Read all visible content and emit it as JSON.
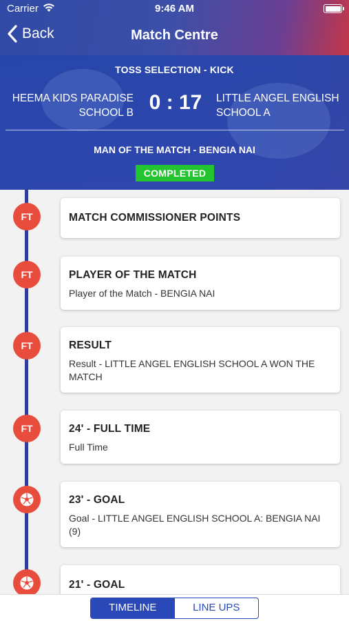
{
  "status_bar": {
    "carrier": "Carrier",
    "time": "9:46 AM"
  },
  "nav": {
    "back_label": "Back",
    "title": "Match Centre"
  },
  "match": {
    "toss": "TOSS SELECTION - KICK",
    "home_team": "HEEMA KIDS PARADISE SCHOOL B",
    "away_team": "LITTLE ANGEL ENGLISH SCHOOL A",
    "home_score": "0",
    "separator": ":",
    "away_score": "17",
    "man_of_match": "MAN OF THE MATCH - BENGIA NAI",
    "status": "COMPLETED"
  },
  "timeline": {
    "items": [
      {
        "marker": "FT",
        "icon": "",
        "title": "MATCH COMMISSIONER POINTS",
        "detail": ""
      },
      {
        "marker": "FT",
        "icon": "",
        "title": "PLAYER OF THE MATCH",
        "detail": "Player of the Match - BENGIA NAI"
      },
      {
        "marker": "FT",
        "icon": "",
        "title": "RESULT",
        "detail": "Result - LITTLE ANGEL ENGLISH SCHOOL A WON THE MATCH"
      },
      {
        "marker": "FT",
        "icon": "",
        "title": "24' - FULL TIME",
        "detail": "Full Time"
      },
      {
        "marker": "",
        "icon": "football-icon",
        "title": "23' - GOAL",
        "detail": "Goal - LITTLE ANGEL ENGLISH SCHOOL A: BENGIA NAI (9)"
      },
      {
        "marker": "",
        "icon": "football-icon",
        "title": "21' - GOAL",
        "detail": ""
      }
    ]
  },
  "tabs": {
    "timeline": "TIMELINE",
    "lineups": "LINE UPS",
    "active": "timeline"
  },
  "colors": {
    "primary": "#2a48b8",
    "timeline_line": "#2d3f9a",
    "marker": "#e74c3c",
    "status_badge": "#22c52f",
    "header_accent": "#e2342f"
  }
}
